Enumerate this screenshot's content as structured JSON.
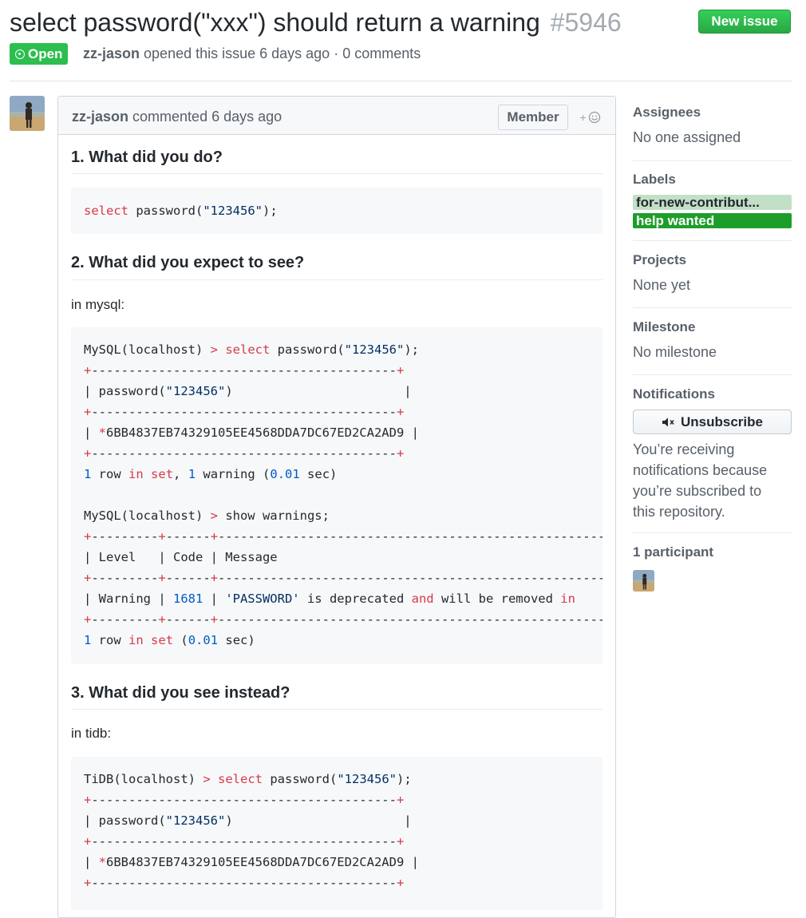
{
  "issue": {
    "title": "select password(\"xxx\") should return a warning",
    "number": "#5946",
    "state": "Open",
    "author": "zz-jason",
    "meta_text": "opened this issue 6 days ago · 0 comments",
    "new_issue_label": "New issue"
  },
  "comment": {
    "author": "zz-jason",
    "action": "commented 6 days ago",
    "role_badge": "Member",
    "reaction_icon": "smiley-icon",
    "sections": [
      {
        "heading": "1. What did you do?"
      },
      {
        "heading": "2. What did you expect to see?",
        "intro": "in mysql:"
      },
      {
        "heading": "3. What did you see instead?",
        "intro": "in tidb:"
      }
    ]
  },
  "sidebar": {
    "assignees": {
      "heading": "Assignees",
      "value": "No one assigned"
    },
    "labels": {
      "heading": "Labels",
      "items": [
        {
          "name": "for-new-contribut...",
          "bg": "#c2e0c6",
          "fg": "#24292e"
        },
        {
          "name": "help wanted",
          "bg": "#1d9e2a",
          "fg": "#ffffff"
        }
      ]
    },
    "projects": {
      "heading": "Projects",
      "value": "None yet"
    },
    "milestone": {
      "heading": "Milestone",
      "value": "No milestone"
    },
    "notifications": {
      "heading": "Notifications",
      "button_label": "Unsubscribe",
      "text": "You’re receiving\nnotifications because\nyou’re subscribed to\nthis repository."
    },
    "participants": {
      "heading": "1 participant"
    }
  },
  "colors": {
    "open_green": "#2cbe4e",
    "keyword_red": "#d73a49",
    "string_navy": "#032f62",
    "number_blue": "#005cc5"
  }
}
